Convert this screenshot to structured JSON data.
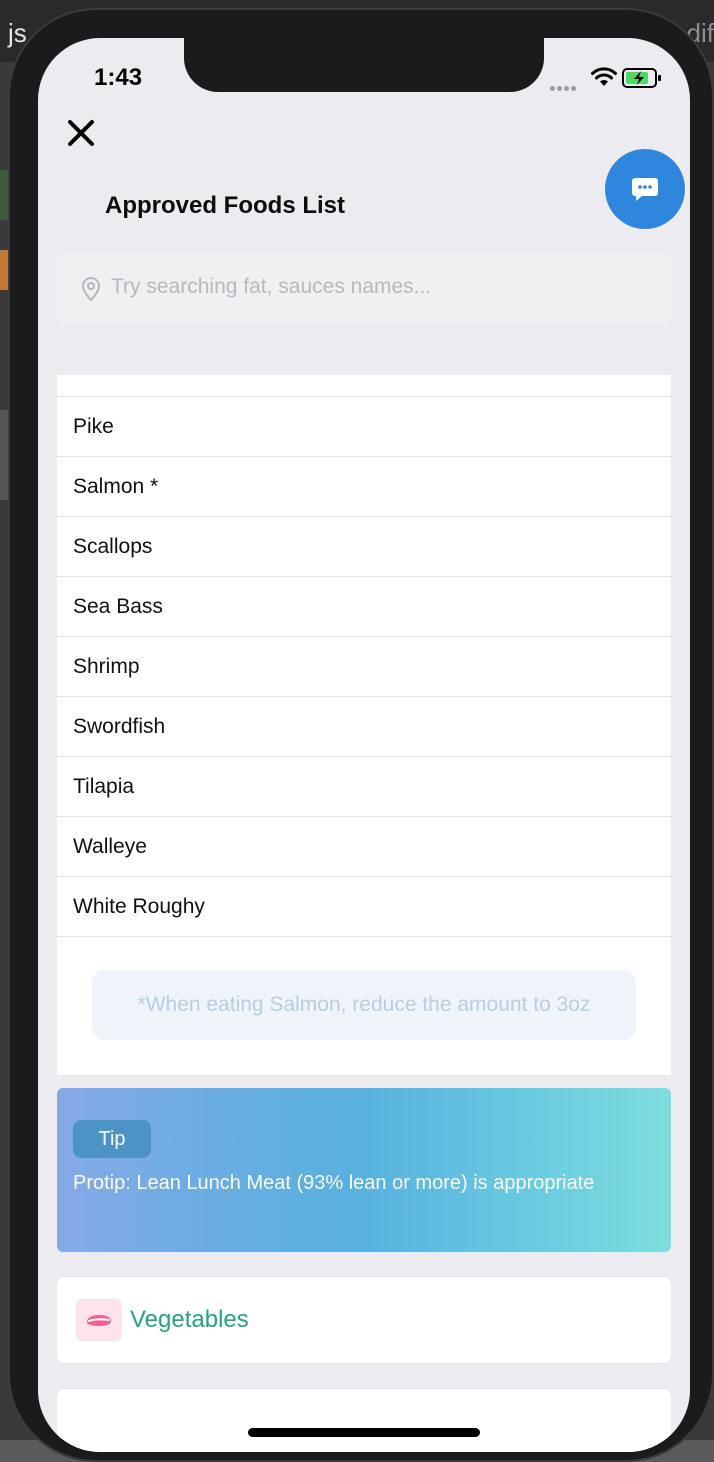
{
  "backdrop": {
    "left_text": "js",
    "right_text": "dif"
  },
  "status_bar": {
    "time": "1:43"
  },
  "header": {
    "title": "Approved Foods List"
  },
  "search": {
    "placeholder": "Try searching fat, sauces names..."
  },
  "foods": {
    "items": [
      {
        "label": "Pike"
      },
      {
        "label": "Salmon *"
      },
      {
        "label": "Scallops"
      },
      {
        "label": "Sea Bass"
      },
      {
        "label": "Shrimp"
      },
      {
        "label": "Swordfish"
      },
      {
        "label": "Tilapia"
      },
      {
        "label": "Walleye"
      },
      {
        "label": "White Roughy"
      }
    ],
    "note": "*When eating Salmon, reduce the amount to 3oz"
  },
  "tip": {
    "badge": "Tip",
    "text": "Protip: Lean Lunch Meat (93% lean or more) is appropriate"
  },
  "category": {
    "label": "Vegetables",
    "icon": "meat-icon"
  },
  "icons": {
    "close": "close-icon",
    "chat": "chat-icon",
    "search": "location-pin-icon",
    "wifi": "wifi-icon",
    "battery": "battery-charging-icon"
  },
  "colors": {
    "accent_blue": "#2f87dd",
    "category_green": "#28a37e",
    "tip_gradient_start": "#86a9e6",
    "tip_gradient_end": "#7dddde"
  }
}
